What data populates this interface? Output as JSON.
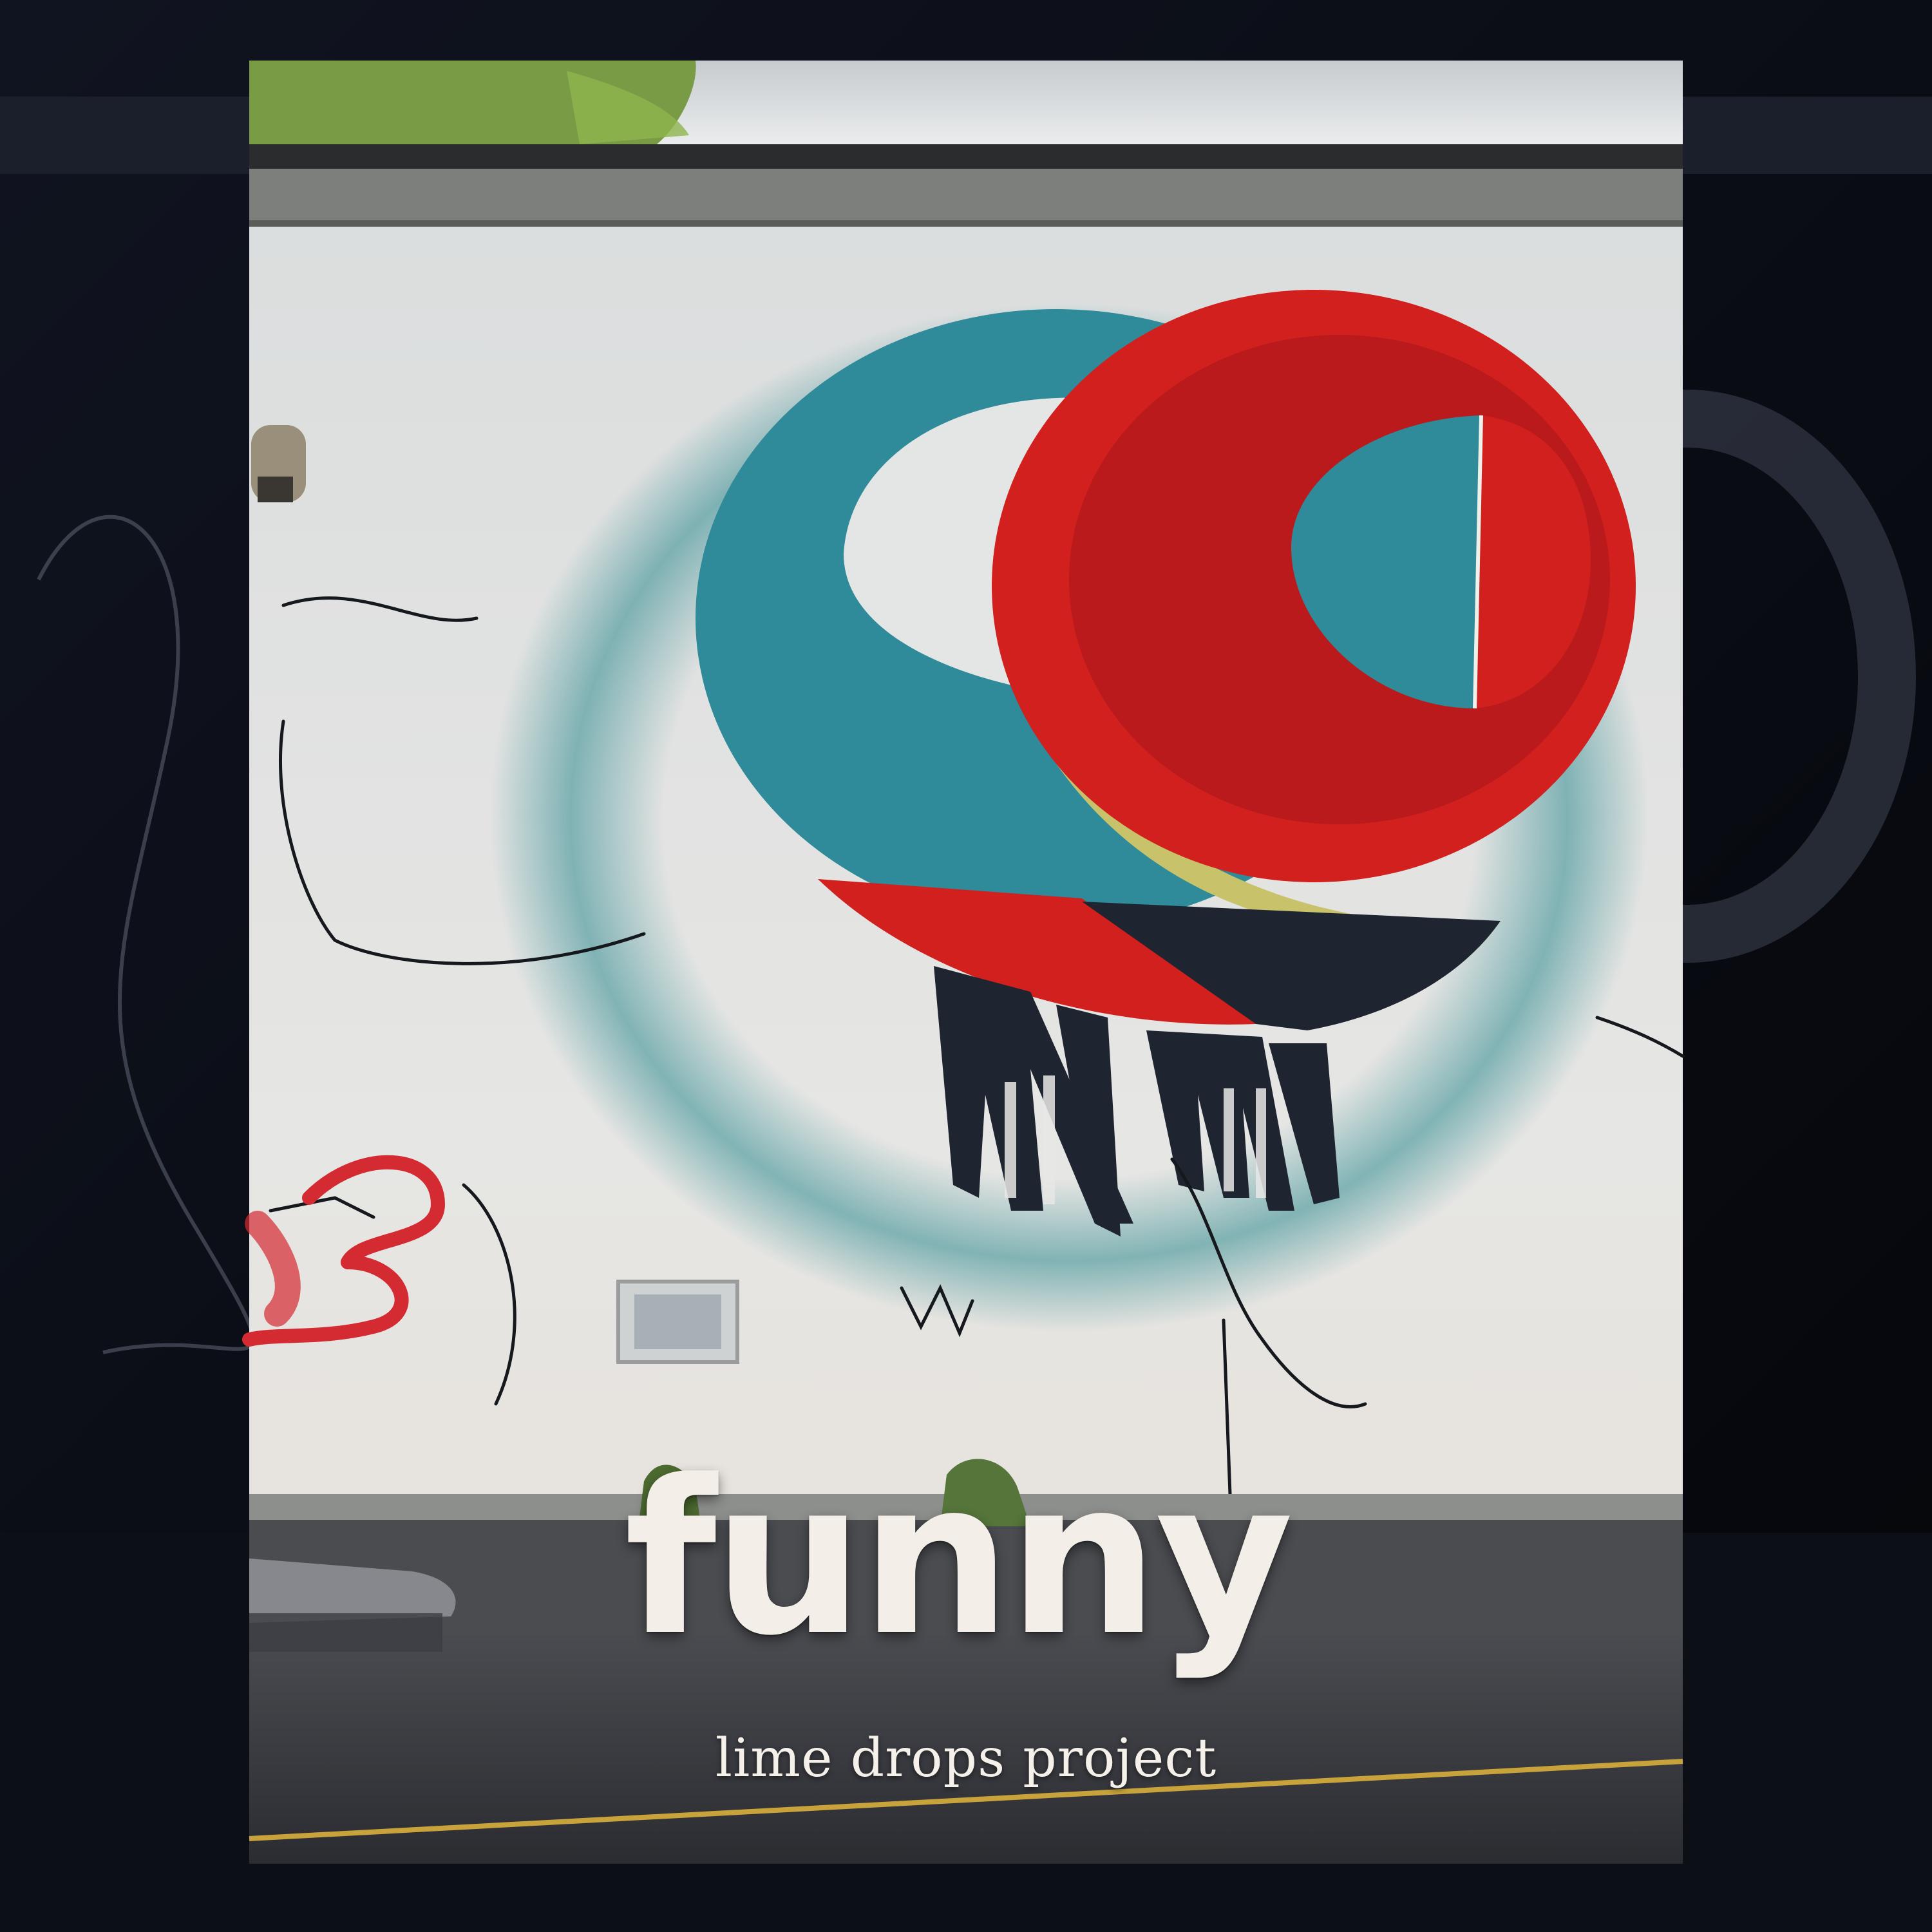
{
  "cover": {
    "title": "funny",
    "artist": "lime drops project"
  },
  "palette": {
    "background": "#06070c",
    "wall": "#e2e4e4",
    "teal": "#2f8a9a",
    "red": "#d1201d",
    "dark": "#1e2530",
    "text": "#f3eee7"
  }
}
